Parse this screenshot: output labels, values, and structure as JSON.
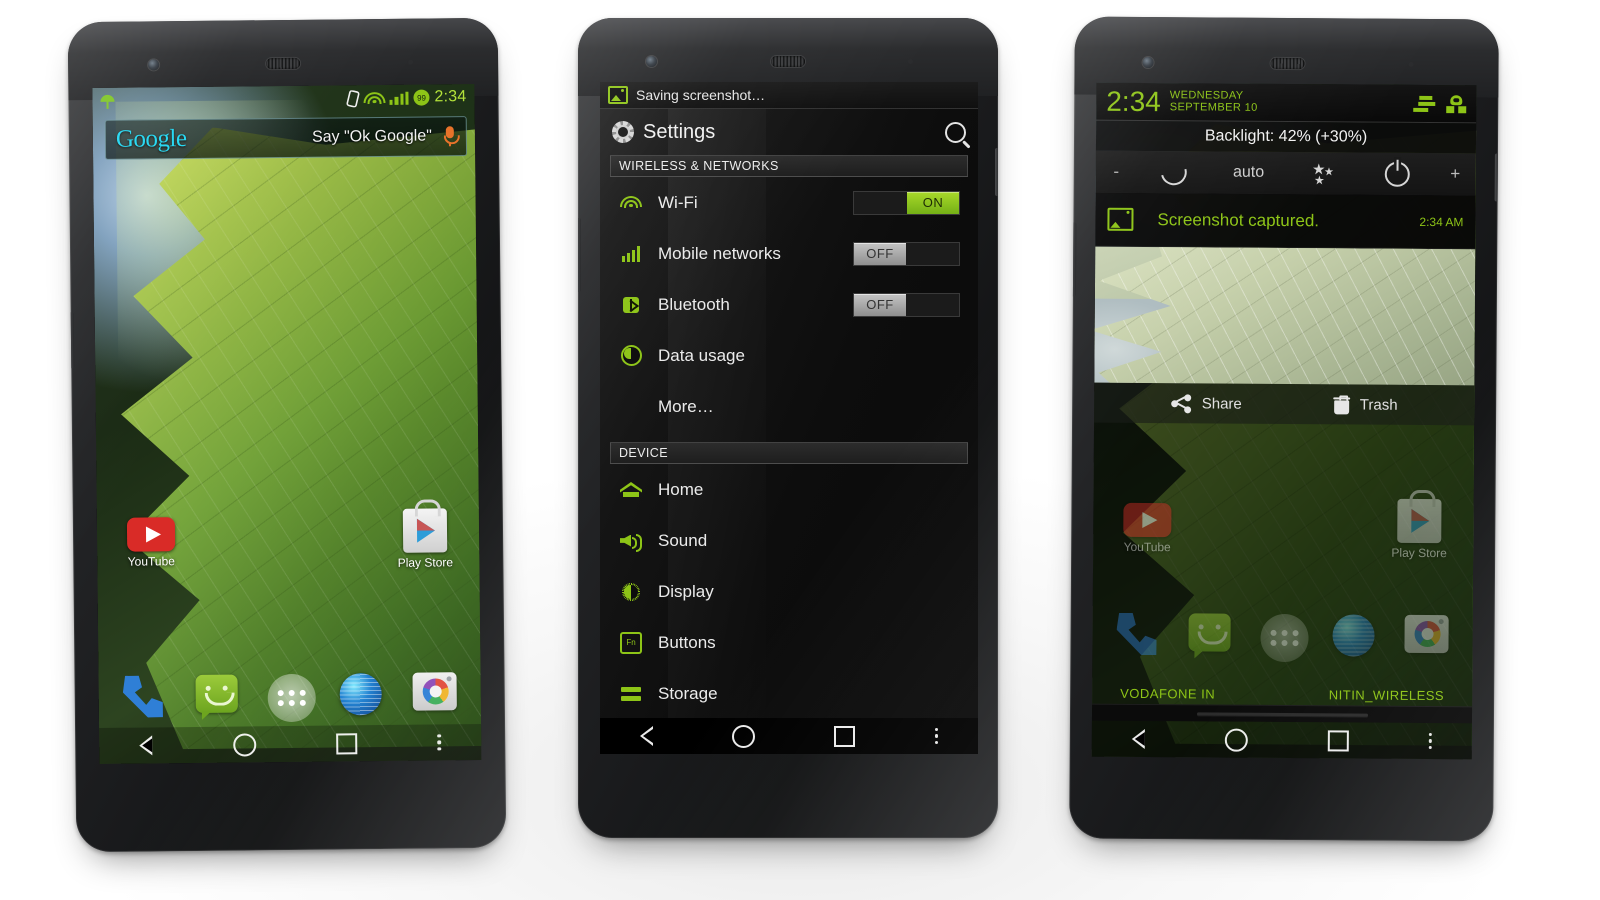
{
  "scene": {
    "device_count": 3,
    "accent_green": "#8dc417",
    "accent_cyan": "#22d7f2"
  },
  "phone1": {
    "name": "home-screen",
    "status_bar": {
      "weather_icon": "umbrella-icon",
      "cast_icon": "screencast-icon",
      "wifi_icon": "wifi-icon",
      "signal_icon": "signal-bars-icon",
      "battery_icon": "battery-circle-icon",
      "battery_level": "99",
      "clock": "2:34"
    },
    "search_widget": {
      "logo": "Google",
      "hint": "Say \"Ok Google\"",
      "mic_icon": "microphone-icon"
    },
    "apps": [
      {
        "label": "YouTube",
        "icon": "youtube-icon"
      },
      {
        "label": "Play Store",
        "icon": "play-store-icon"
      }
    ],
    "dock": [
      {
        "icon": "phone-dialer-icon",
        "label": "Phone"
      },
      {
        "icon": "messaging-icon",
        "label": "Messaging"
      },
      {
        "icon": "app-drawer-icon",
        "label": "Apps"
      },
      {
        "icon": "browser-icon",
        "label": "Browser"
      },
      {
        "icon": "camera-icon",
        "label": "Camera"
      }
    ],
    "navbar": [
      {
        "icon": "back-icon"
      },
      {
        "icon": "home-icon"
      },
      {
        "icon": "recents-icon"
      },
      {
        "icon": "overflow-menu-icon"
      }
    ]
  },
  "phone2": {
    "name": "settings-screen",
    "notification": {
      "icon": "image-icon",
      "text": "Saving screenshot…"
    },
    "header": {
      "icon": "gear-icon",
      "title": "Settings",
      "search_icon": "search-icon"
    },
    "sections": [
      {
        "header": "WIRELESS & NETWORKS",
        "rows": [
          {
            "label": "Wi-Fi",
            "icon": "wifi-icon",
            "toggle": "ON",
            "state": "on"
          },
          {
            "label": "Mobile networks",
            "icon": "signal-bars-icon",
            "toggle": "OFF",
            "state": "off"
          },
          {
            "label": "Bluetooth",
            "icon": "bluetooth-icon",
            "toggle": "OFF",
            "state": "off"
          },
          {
            "label": "Data usage",
            "icon": "data-usage-icon",
            "toggle": null,
            "state": null
          },
          {
            "label": "More…",
            "icon": null,
            "toggle": null,
            "state": null
          }
        ]
      },
      {
        "header": "DEVICE",
        "rows": [
          {
            "label": "Home",
            "icon": "home-icon",
            "toggle": null,
            "state": null
          },
          {
            "label": "Sound",
            "icon": "sound-icon",
            "toggle": null,
            "state": null
          },
          {
            "label": "Display",
            "icon": "display-icon",
            "toggle": null,
            "state": null
          },
          {
            "label": "Buttons",
            "icon": "fn-buttons-icon",
            "toggle": null,
            "state": null
          },
          {
            "label": "Storage",
            "icon": "storage-icon",
            "toggle": null,
            "state": null
          }
        ]
      }
    ],
    "navbar": [
      {
        "icon": "back-icon"
      },
      {
        "icon": "home-icon"
      },
      {
        "icon": "recents-icon"
      },
      {
        "icon": "overflow-menu-icon"
      }
    ]
  },
  "phone3": {
    "name": "notification-shade",
    "clock_bar": {
      "time": "2:34",
      "day": "WEDNESDAY",
      "date": "SEPTEMBER 10",
      "sliders_icon": "quick-settings-sliders-icon",
      "user_icon": "user-profile-icon"
    },
    "backlight": {
      "text": "Backlight: 42% (+30%)",
      "value": 42,
      "delta": "+30%"
    },
    "controls": [
      {
        "label": "-",
        "icon": "minus-icon"
      },
      {
        "label": "",
        "icon": "refresh-icon"
      },
      {
        "label": "auto",
        "icon": null
      },
      {
        "label": "",
        "icon": "stars-icon"
      },
      {
        "label": "",
        "icon": "power-icon"
      },
      {
        "label": "+",
        "icon": "plus-icon"
      }
    ],
    "notification": {
      "icon": "image-icon",
      "title": "Screenshot captured.",
      "time": "2:34 AM"
    },
    "actions": [
      {
        "label": "Share",
        "icon": "share-icon"
      },
      {
        "label": "Trash",
        "icon": "trash-icon"
      }
    ],
    "carriers": {
      "left": "VODAFONE IN",
      "right": "NITIN_WIRELESS"
    },
    "navbar": [
      {
        "icon": "back-icon"
      },
      {
        "icon": "home-icon"
      },
      {
        "icon": "recents-icon"
      },
      {
        "icon": "overflow-menu-icon"
      }
    ]
  }
}
